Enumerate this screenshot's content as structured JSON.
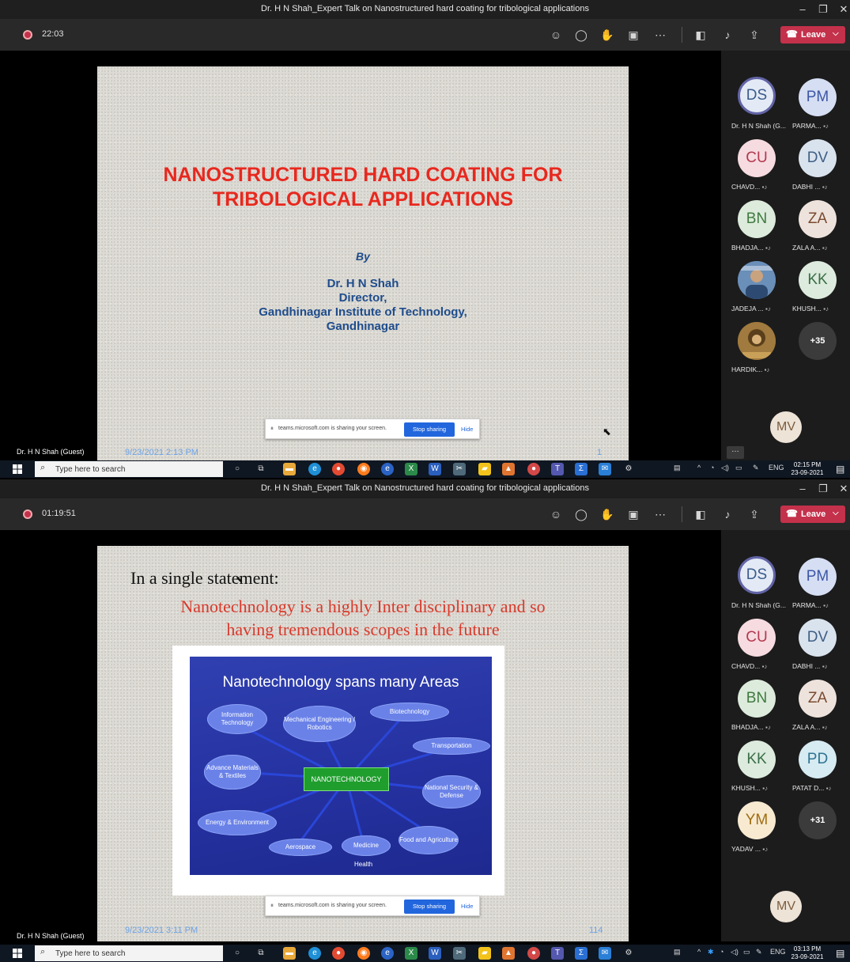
{
  "window": {
    "title": "Dr. H N Shah_Expert Talk on Nanostructured hard coating for tribological applications",
    "minimize_glyph": "–",
    "restore_glyph": "❐",
    "close_glyph": "✕"
  },
  "toolbar": {
    "leave_label": "Leave",
    "leave_chevron": "⌵",
    "icons": [
      "people-icon",
      "chat-icon",
      "reactions-icon",
      "rooms-icon",
      "more-icon",
      "camera-off-icon",
      "mic-off-icon",
      "share-icon"
    ]
  },
  "share_bar": {
    "message": "teams.microsoft.com is sharing your screen.",
    "stop_label": "Stop sharing",
    "hide_label": "Hide"
  },
  "presenter": "Dr. H N Shah (Guest)",
  "taskbar": {
    "search_placeholder": "Type here to search",
    "language": "ENG"
  },
  "screens": [
    {
      "timer": "22:03",
      "slide": {
        "title_line1": "NANOSTRUCTURED HARD COATING FOR",
        "title_line2": "TRIBOLOGICAL APPLICATIONS",
        "by": "By",
        "author_name": "Dr. H N Shah",
        "author_role": "Director,",
        "author_org": "Gandhinagar Institute of Technology,",
        "author_city": "Gandhinagar",
        "date": "9/23/2021 2:13 PM",
        "number": "1"
      },
      "participants": [
        {
          "initials": "DS",
          "name": "Dr. H N Shah (G...",
          "bg": "#e4eaf5",
          "fg": "#3a5a8c",
          "ring": true
        },
        {
          "initials": "PM",
          "name": "PARMA...",
          "bg": "#d5def3",
          "fg": "#3d57a6"
        },
        {
          "initials": "CU",
          "name": "CHAVD...",
          "bg": "#f6dbe0",
          "fg": "#b4384e"
        },
        {
          "initials": "DV",
          "name": "DABHI ...",
          "bg": "#d9e3ee",
          "fg": "#3e5f85"
        },
        {
          "initials": "BN",
          "name": "BHADJA...",
          "bg": "#dcebdc",
          "fg": "#3f7a3f"
        },
        {
          "initials": "ZA",
          "name": "ZALA A...",
          "bg": "#eee3dc",
          "fg": "#7a4a30"
        },
        {
          "initials": "",
          "name": "JADEJA ...",
          "photo": "photo-avatar-1"
        },
        {
          "initials": "KK",
          "name": "KHUSH...",
          "bg": "#dcebdd",
          "fg": "#3a6e47"
        },
        {
          "initials": "",
          "name": "HARDIK...",
          "photo": "photo-avatar-2"
        }
      ],
      "more_count": "+35",
      "self_initials": "MV",
      "clock_time": "02:15 PM",
      "clock_date": "23-09-2021"
    },
    {
      "timer": "01:19:51",
      "slide": {
        "heading": "In a single statement:",
        "sub_line1": "Nanotechnology is a highly Inter disciplinary and so",
        "sub_line2": "having tremendous scopes in the future",
        "diagram_title": "Nanotechnology spans many Areas",
        "diagram_core": "NANOTECHNOLOGY",
        "areas": [
          "Information Technology",
          "Mechanical Engineering / Robotics",
          "Biotechnology",
          "Transportation",
          "Advance Materials & Textiles",
          "National Security & Defense",
          "Energy & Environment",
          "Aerospace",
          "Medicine",
          "Food and Agriculture"
        ],
        "health": "Health",
        "date": "9/23/2021 3:11 PM",
        "number": "114"
      },
      "participants": [
        {
          "initials": "DS",
          "name": "Dr. H N Shah (G...",
          "bg": "#e4eaf5",
          "fg": "#3a5a8c",
          "ring": true
        },
        {
          "initials": "PM",
          "name": "PARMA...",
          "bg": "#d5def3",
          "fg": "#3d57a6"
        },
        {
          "initials": "CU",
          "name": "CHAVD...",
          "bg": "#f6dbe0",
          "fg": "#b4384e"
        },
        {
          "initials": "DV",
          "name": "DABHI ...",
          "bg": "#d9e3ee",
          "fg": "#3e5f85"
        },
        {
          "initials": "BN",
          "name": "BHADJA...",
          "bg": "#dcebdc",
          "fg": "#3f7a3f"
        },
        {
          "initials": "ZA",
          "name": "ZALA A...",
          "bg": "#eee3dc",
          "fg": "#7a4a30"
        },
        {
          "initials": "KK",
          "name": "KHUSH...",
          "bg": "#dcebdd",
          "fg": "#3a6e47"
        },
        {
          "initials": "PD",
          "name": "PATAT D...",
          "bg": "#d6ebf2",
          "fg": "#2f7491"
        },
        {
          "initials": "YM",
          "name": "YADAV ...",
          "bg": "#f7ead1",
          "fg": "#a06d12"
        }
      ],
      "more_count": "+31",
      "self_initials": "MV",
      "clock_time": "03:13 PM",
      "clock_date": "23-09-2021"
    }
  ]
}
